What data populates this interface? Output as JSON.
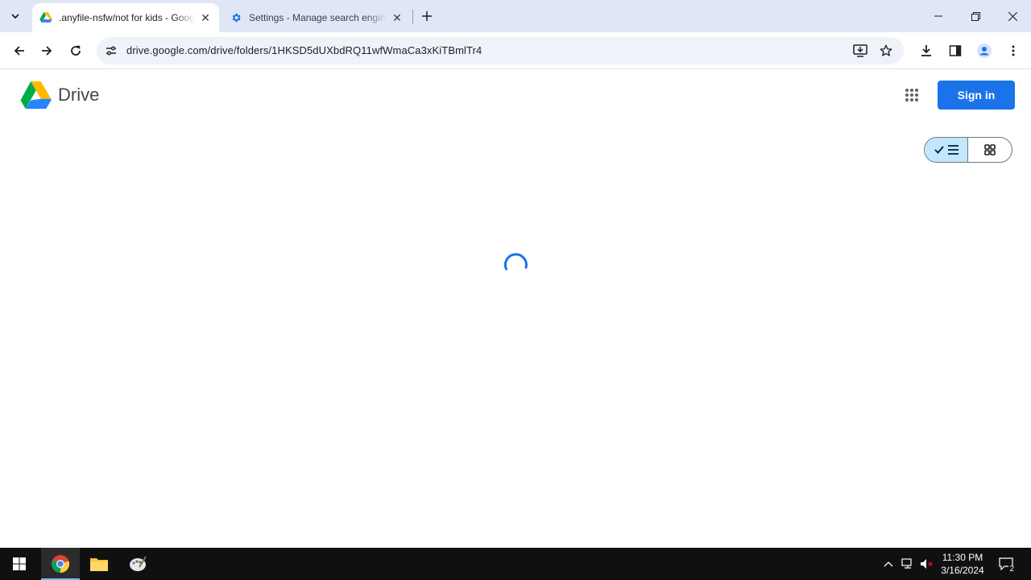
{
  "browser": {
    "tabs": [
      {
        "title": ".anyfile-nsfw/not for kids - Google Drive",
        "active": true
      },
      {
        "title": "Settings - Manage search engines",
        "active": false
      }
    ],
    "url": "drive.google.com/drive/folders/1HKSD5dUXbdRQ11wfWmaCa3xKiTBmlTr4"
  },
  "drive": {
    "logo_text": "Drive",
    "sign_in_label": "Sign in"
  },
  "colors": {
    "accent": "#1a73e8",
    "tabstrip": "#dfe6f5",
    "toggle_selected": "#c2e7ff"
  },
  "taskbar": {
    "time": "11:30 PM",
    "date": "3/16/2024",
    "notification_count": "2"
  }
}
